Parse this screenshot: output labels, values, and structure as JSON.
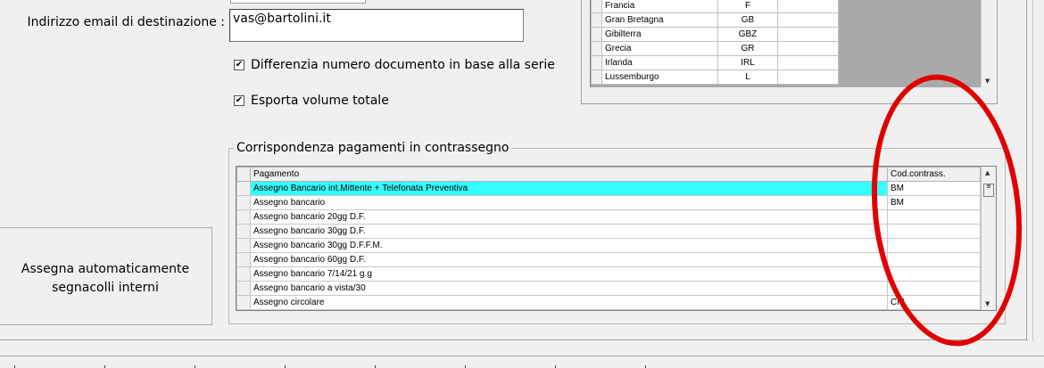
{
  "form": {
    "email_label": "Indirizzo email di destinazione :",
    "email_value": "vas@bartolini.it",
    "checkbox_series_label": "Differenzia numero documento in base alla serie",
    "checkbox_series_checked": true,
    "checkbox_volume_label": "Esporta volume totale",
    "checkbox_volume_checked": true,
    "check_glyph": "✔"
  },
  "countries": [
    {
      "name": "Francia",
      "code": "F"
    },
    {
      "name": "Gran Bretagna",
      "code": "GB"
    },
    {
      "name": "Gibilterra",
      "code": "GBZ"
    },
    {
      "name": "Grecia",
      "code": "GR"
    },
    {
      "name": "Irlanda",
      "code": "IRL"
    },
    {
      "name": "Lussemburgo",
      "code": "L"
    }
  ],
  "payments_group": {
    "title": "Corrispondenza pagamenti in contrassegno",
    "col_payment": "Pagamento",
    "col_code": "Cod.contrass.",
    "rows": [
      {
        "payment": "Assegno Bancario int.Mittente + Telefonata Preventiva",
        "code": "BM",
        "selected": true
      },
      {
        "payment": "Assegno bancario",
        "code": "BM"
      },
      {
        "payment": "Assegno bancario 20gg D.F.",
        "code": ""
      },
      {
        "payment": "Assegno bancario 30gg D.F.",
        "code": ""
      },
      {
        "payment": "Assegno bancario 30gg D.F.F.M.",
        "code": ""
      },
      {
        "payment": "Assegno bancario 60gg D.F.",
        "code": ""
      },
      {
        "payment": "Assegno bancario 7/14/21 g.g",
        "code": ""
      },
      {
        "payment": "Assegno bancario a vista/30",
        "code": ""
      },
      {
        "payment": "Assegno circolare",
        "code": "CM"
      }
    ]
  },
  "assign_button": {
    "line1": "Assegna automaticamente",
    "line2": "segnacolli interni"
  },
  "colors": {
    "selection": "#33ffff",
    "annotation": "#e00000"
  }
}
